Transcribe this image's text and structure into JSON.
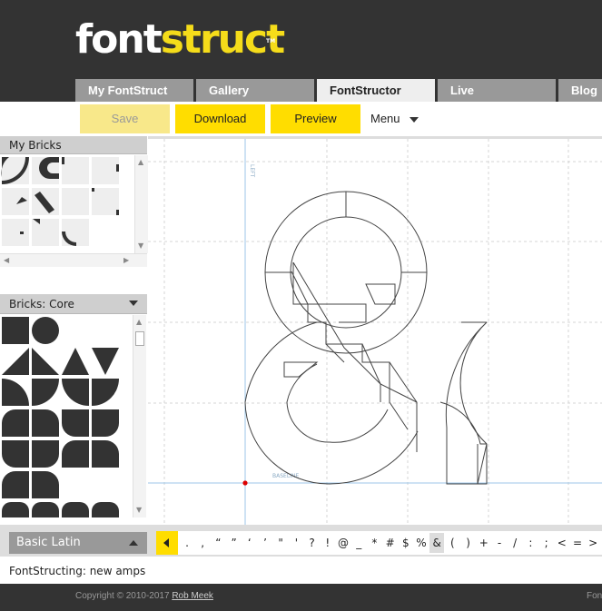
{
  "logo": {
    "part1": "font",
    "part2": "struct",
    "tm": "TM"
  },
  "nav_tabs": [
    {
      "label": "My FontStruct",
      "active": false
    },
    {
      "label": "Gallery",
      "active": false
    },
    {
      "label": "FontStructor",
      "active": true
    },
    {
      "label": "Live",
      "active": false
    },
    {
      "label": "Blog",
      "active": false
    }
  ],
  "toolbar": {
    "save_label": "Save",
    "download_label": "Download",
    "preview_label": "Preview",
    "menu_label": "Menu"
  },
  "panels": {
    "my_bricks_title": "My Bricks",
    "bricks_core_title": "Bricks: Core"
  },
  "canvas": {
    "left_label": "LEFT",
    "baseline_label": "BASELINE",
    "glyph": "&"
  },
  "charset": {
    "selector_label": "Basic Latin",
    "characters": [
      ".",
      ",",
      "“",
      "”",
      "‘",
      "’",
      "\"",
      "'",
      "?",
      "!",
      "@",
      "_",
      "*",
      "#",
      "$",
      "%",
      "&",
      "(",
      ")",
      "+",
      "-",
      "/",
      ":",
      ";",
      "<",
      "=",
      ">"
    ],
    "selected": "&"
  },
  "status_text": "FontStructing: new amps",
  "footer": {
    "copyright": "Copyright © 2010-2017",
    "author": "Rob Meek",
    "right_text": "Fon"
  },
  "colors": {
    "accent": "#ffdd00",
    "dark": "#333333",
    "tab_inactive": "#999999",
    "guide": "#9cc6e8",
    "origin": "#dd0000"
  }
}
